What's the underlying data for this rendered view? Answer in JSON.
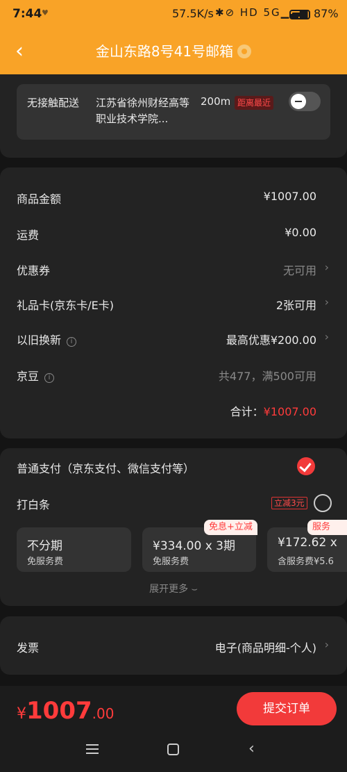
{
  "status": {
    "time": "7:44",
    "tiny": "♥",
    "net": "57.5K/s",
    "icons": "✱⊘ HD 5G▁▃▅",
    "battery": "87%"
  },
  "header": {
    "title": "金山东路8号41号邮箱"
  },
  "delivery": {
    "label": "无接触配送",
    "address": "江苏省徐州财经高等职业技术学院...",
    "distance": "200m",
    "tag": "距离最近"
  },
  "summary": {
    "rows": [
      {
        "label": "商品金额",
        "value": "¥1007.00"
      },
      {
        "label": "运费",
        "value": "¥0.00"
      },
      {
        "label": "优惠券",
        "value": "无可用"
      },
      {
        "label": "礼品卡(京东卡/E卡)",
        "value": "2张可用"
      },
      {
        "label": "以旧换新",
        "value": "最高优惠¥200.00"
      },
      {
        "label": "京豆",
        "value": "共477，满500可用"
      }
    ],
    "total_label": "合计：",
    "total_value": "¥1007.00"
  },
  "payment": {
    "normal": "普通支付（京东支付、微信支付等）",
    "baitiao": "打白条",
    "baitiao_tag": "立减3元",
    "options": [
      {
        "main": "不分期",
        "sub": "免服务费"
      },
      {
        "main": "¥334.00 x 3期",
        "sub": "免服务费"
      },
      {
        "main": "¥172.62 x",
        "sub": "含服务费¥5.6"
      }
    ],
    "option_tags": [
      "免息+立减",
      "服务"
    ],
    "more": "展开更多 ⌣"
  },
  "invoice": {
    "label": "发票",
    "value": "电子(商品明细-个人)"
  },
  "footer": {
    "currency": "¥",
    "price_int": "1007",
    "price_dec": ".00",
    "submit": "提交订单"
  },
  "colors": {
    "accent": "#f9a327",
    "red": "#f23a3a",
    "bg": "#141414",
    "card": "#232323"
  }
}
